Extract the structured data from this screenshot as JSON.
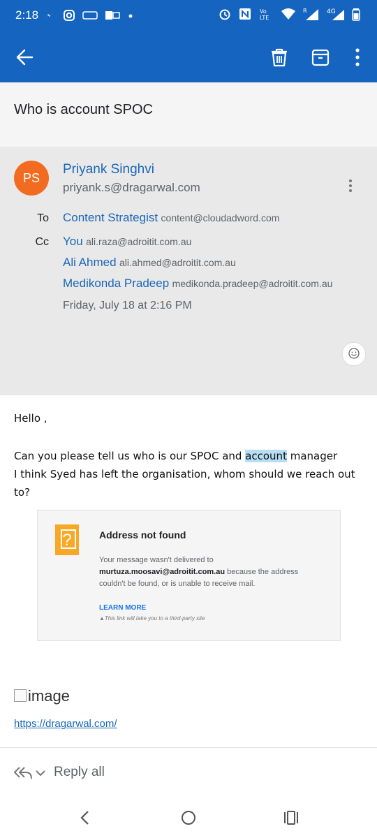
{
  "status_bar": {
    "time": "2:18",
    "left_icons": [
      "messenger-icon",
      "instagram-icon",
      "gaana-icon",
      "outlook-icon",
      "dot-icon"
    ],
    "right_icons": [
      "alarm-icon",
      "nfc-icon",
      "volte-icon",
      "wifi-icon",
      "signal-r-icon",
      "signal-4g-icon",
      "signal-icon",
      "battery-icon"
    ],
    "volte_label": "Vo\nLTE",
    "network_label": "4G"
  },
  "toolbar": {
    "back_icon": "arrow-left-icon",
    "delete_icon": "trash-icon",
    "archive_icon": "archive-icon",
    "more_icon": "kebab-icon"
  },
  "subject": "Who is account SPOC",
  "sender": {
    "initials": "PS",
    "name": "Priyank Singhvi",
    "email": "priyank.s@dragarwal.com",
    "avatar_color": "#f26b21"
  },
  "recipients": {
    "to_label": "To",
    "cc_label": "Cc",
    "to": [
      {
        "name": "Content Strategist",
        "email": "content@cloudadword.com"
      }
    ],
    "cc": [
      {
        "name": "You",
        "email": "ali.raza@adroitit.com.au"
      },
      {
        "name": "Ali Ahmed",
        "email": "ali.ahmed@adroitit.com.au"
      },
      {
        "name": "Medikonda Pradeep",
        "email": "medikonda.pradeep@adroitit.com.au"
      }
    ]
  },
  "date": "Friday, July 18 at 2:16 PM",
  "body": {
    "greeting": "Hello ,",
    "line1_before": "Can you please tell us who is our SPOC and ",
    "line1_highlight": "account",
    "line1_after": " manager",
    "line2": "I think Syed has left the organisation, whom should we reach out to?"
  },
  "not_found_card": {
    "title": "Address not found",
    "desc_prefix": "Your message wasn't delivered to",
    "address": "murtuza.moosavi@adroitit.com.au",
    "desc_suffix": " because the address couldn't be found, or is unable to receive mail.",
    "learn_more": "LEARN MORE",
    "note": "This link will take you to a third-party site",
    "icon_char": "?"
  },
  "broken_image_alt": "image",
  "link": "https://dragarwal.com/",
  "reply": {
    "label": "Reply all"
  },
  "colors": {
    "primary": "#1565c0",
    "link": "#1a66b8",
    "highlight": "#b8def5",
    "warning_icon": "#f9a825"
  }
}
